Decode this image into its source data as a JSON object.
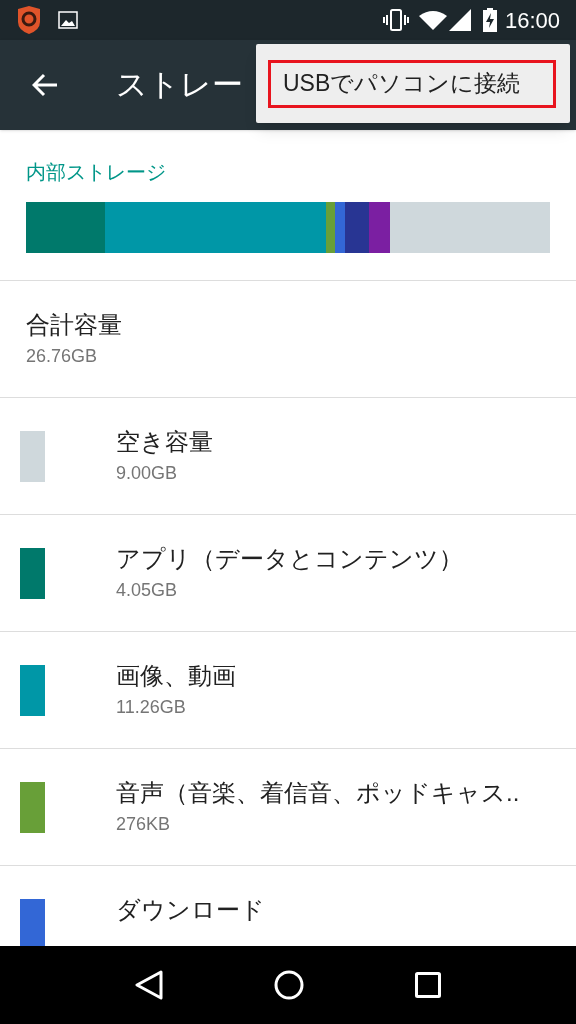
{
  "status_bar": {
    "time": "16:00"
  },
  "toolbar": {
    "title": "ストレー"
  },
  "overflow_menu": {
    "items": [
      {
        "label": "USBでパソコンに接続",
        "highlighted": true
      }
    ]
  },
  "section": {
    "title": "内部ストレージ"
  },
  "usage_bar": {
    "segments": [
      {
        "color": "#00796b"
      },
      {
        "color": "#0097a7"
      },
      {
        "color": "#689f38"
      },
      {
        "color": "#3367d6"
      },
      {
        "color": "#283593"
      },
      {
        "color": "#7b1fa2"
      },
      {
        "color": "#cfd8dc"
      }
    ]
  },
  "total": {
    "label": "合計容量",
    "value": "26.76GB"
  },
  "categories": [
    {
      "label": "空き容量",
      "value": "9.00GB",
      "color": "#cfd8dc"
    },
    {
      "label": "アプリ（データとコンテンツ）",
      "value": "4.05GB",
      "color": "#00796b"
    },
    {
      "label": "画像、動画",
      "value": "11.26GB",
      "color": "#0097a7"
    },
    {
      "label": "音声（音楽、着信音、ポッドキャス..",
      "value": "276KB",
      "color": "#689f38"
    },
    {
      "label": "ダウンロード",
      "color": "#3367d6"
    }
  ]
}
